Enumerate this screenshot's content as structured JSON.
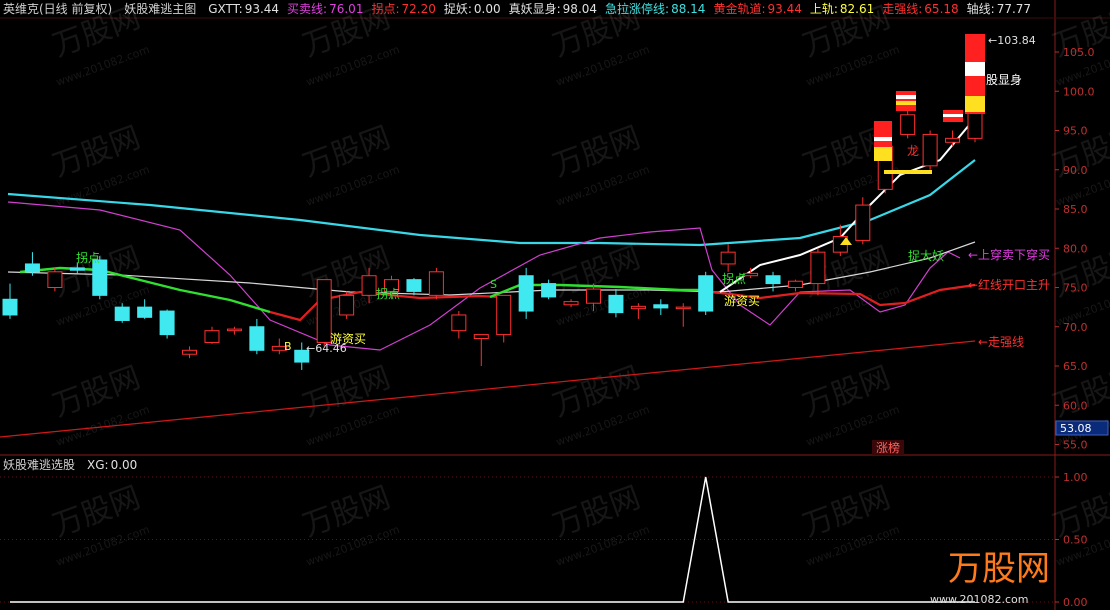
{
  "main_panel": {
    "indicators": [
      {
        "label": "英维克(日线 前复权)",
        "value": "",
        "color": "#cfcfcf"
      },
      {
        "label": "妖股难逃主图",
        "value": "",
        "color": "#cfcfcf"
      },
      {
        "label": "GXTT:",
        "value": "93.44",
        "color": "#e0e0e0"
      },
      {
        "label": "买卖线:",
        "value": "76.01",
        "color": "#e040e0"
      },
      {
        "label": "拐点:",
        "value": "72.20",
        "color": "#ff3030"
      },
      {
        "label": "捉妖:",
        "value": "0.00",
        "color": "#e0e0e0"
      },
      {
        "label": "真妖显身:",
        "value": "98.04",
        "color": "#e0e0e0"
      },
      {
        "label": "急拉涨停线:",
        "value": "88.14",
        "color": "#40e0e0"
      },
      {
        "label": "黄金轨道:",
        "value": "93.44",
        "color": "#ff3030"
      },
      {
        "label": "上轨:",
        "value": "82.61",
        "color": "#ffff40"
      },
      {
        "label": "走强线:",
        "value": "65.18",
        "color": "#ff3030"
      },
      {
        "label": "轴线:",
        "value": "77.77",
        "color": "#e0e0e0"
      }
    ],
    "y_axis_ticks": [
      "105.0",
      "100.0",
      "95.0",
      "90.0",
      "85.0",
      "80.0",
      "75.0",
      "70.0",
      "65.0",
      "60.0",
      "55.0"
    ],
    "current_price_label": "53.08",
    "annotations": {
      "high_price": "103.84",
      "low_price": "64.46",
      "guaidian_1": "拐点",
      "guaidian_2": "拐点",
      "guaidian_3": "拐点",
      "youzi_buy_1": "游资买",
      "youzi_buy_2": "游资买",
      "b_mark": "B",
      "s_mark": "S",
      "long": "龙",
      "gu_xianshen": "股显身",
      "zhuo_da_yao": "捉大妖",
      "shangchuan": "上穿卖下穿买",
      "hongxian": "红线开口主升",
      "zouqiang": "走强线",
      "zhangbang": "涨榜"
    }
  },
  "sub_panel": {
    "indicators": [
      {
        "label": "妖股难逃选股",
        "value": "",
        "color": "#cfcfcf"
      },
      {
        "label": "XG:",
        "value": "0.00",
        "color": "#e0e0e0"
      }
    ],
    "y_axis_ticks": [
      "1.00",
      "0.50",
      "0.00"
    ]
  },
  "watermark": {
    "brand": "万股网",
    "url": "www.201082.com"
  },
  "chart_data": [
    {
      "type": "candlestick",
      "title": "英维克(日线 前复权)",
      "ylim": [
        52,
        106
      ],
      "candles": [
        {
          "o": 73.5,
          "h": 75.5,
          "l": 71.0,
          "c": 71.5
        },
        {
          "o": 78.0,
          "h": 79.5,
          "l": 76.5,
          "c": 77.0
        },
        {
          "o": 75.0,
          "h": 77.5,
          "l": 74.5,
          "c": 77.0
        },
        {
          "o": 77.5,
          "h": 78.2,
          "l": 76.8,
          "c": 77.2
        },
        {
          "o": 78.5,
          "h": 79.0,
          "l": 73.5,
          "c": 74.0
        },
        {
          "o": 72.5,
          "h": 73.0,
          "l": 70.5,
          "c": 70.8
        },
        {
          "o": 72.5,
          "h": 73.5,
          "l": 71.0,
          "c": 71.2
        },
        {
          "o": 72.0,
          "h": 72.2,
          "l": 68.5,
          "c": 69.0
        },
        {
          "o": 66.5,
          "h": 67.5,
          "l": 66.0,
          "c": 67.0
        },
        {
          "o": 68.0,
          "h": 70.0,
          "l": 67.8,
          "c": 69.5
        },
        {
          "o": 69.5,
          "h": 70.0,
          "l": 69.0,
          "c": 69.7
        },
        {
          "o": 70.0,
          "h": 71.0,
          "l": 66.5,
          "c": 67.0
        },
        {
          "o": 67.0,
          "h": 68.5,
          "l": 66.5,
          "c": 67.5
        },
        {
          "o": 67.0,
          "h": 68.0,
          "l": 64.5,
          "c": 65.5
        },
        {
          "o": 68.0,
          "h": 76.0,
          "l": 67.5,
          "c": 76.0
        },
        {
          "o": 71.5,
          "h": 74.5,
          "l": 71.0,
          "c": 74.0
        },
        {
          "o": 74.0,
          "h": 77.5,
          "l": 73.0,
          "c": 76.5
        },
        {
          "o": 74.5,
          "h": 76.5,
          "l": 73.5,
          "c": 76.0
        },
        {
          "o": 76.0,
          "h": 76.2,
          "l": 74.0,
          "c": 74.5
        },
        {
          "o": 74.0,
          "h": 77.5,
          "l": 73.5,
          "c": 77.0
        },
        {
          "o": 69.5,
          "h": 72.0,
          "l": 68.5,
          "c": 71.5
        },
        {
          "o": 68.5,
          "h": 69.0,
          "l": 65.0,
          "c": 69.0
        },
        {
          "o": 69.0,
          "h": 74.0,
          "l": 68.0,
          "c": 74.0
        },
        {
          "o": 76.5,
          "h": 77.5,
          "l": 71.0,
          "c": 72.0
        },
        {
          "o": 75.5,
          "h": 76.0,
          "l": 73.5,
          "c": 73.8
        },
        {
          "o": 72.8,
          "h": 73.5,
          "l": 72.5,
          "c": 73.2
        },
        {
          "o": 73.0,
          "h": 75.5,
          "l": 72.0,
          "c": 74.8
        },
        {
          "o": 74.0,
          "h": 74.8,
          "l": 71.2,
          "c": 71.8
        },
        {
          "o": 72.3,
          "h": 73.0,
          "l": 71.0,
          "c": 72.6
        },
        {
          "o": 72.8,
          "h": 73.5,
          "l": 71.5,
          "c": 72.4
        },
        {
          "o": 72.5,
          "h": 73.0,
          "l": 70.0,
          "c": 72.5
        },
        {
          "o": 76.5,
          "h": 77.0,
          "l": 71.5,
          "c": 72.0
        },
        {
          "o": 78.0,
          "h": 80.5,
          "l": 77.0,
          "c": 79.5
        },
        {
          "o": 76.5,
          "h": 77.5,
          "l": 76.2,
          "c": 76.8
        },
        {
          "o": 76.5,
          "h": 77.0,
          "l": 74.5,
          "c": 75.5
        },
        {
          "o": 75.0,
          "h": 76.0,
          "l": 74.5,
          "c": 75.8
        },
        {
          "o": 75.5,
          "h": 80.0,
          "l": 74.0,
          "c": 79.5
        },
        {
          "o": 79.5,
          "h": 83.0,
          "l": 79.0,
          "c": 81.5
        },
        {
          "o": 81.0,
          "h": 86.5,
          "l": 80.5,
          "c": 85.5
        },
        {
          "o": 87.5,
          "h": 94.5,
          "l": 87.0,
          "c": 93.0
        },
        {
          "o": 94.5,
          "h": 99.5,
          "l": 94.0,
          "c": 97.0
        },
        {
          "o": 90.5,
          "h": 95.0,
          "l": 90.0,
          "c": 94.5
        },
        {
          "o": 93.5,
          "h": 95.0,
          "l": 93.0,
          "c": 94.0
        },
        {
          "o": 94.0,
          "h": 103.84,
          "l": 93.5,
          "c": 103.84
        }
      ]
    },
    {
      "type": "line",
      "title": "妖股难逃选股",
      "ylim": [
        0,
        1.1
      ],
      "values": [
        0,
        0,
        0,
        0,
        0,
        0,
        0,
        0,
        0,
        0,
        0,
        0,
        0,
        0,
        0,
        0,
        0,
        0,
        0,
        0,
        0,
        0,
        0,
        0,
        0,
        0,
        0,
        0,
        0,
        0,
        0,
        1,
        0,
        0,
        0,
        0,
        0,
        0,
        0,
        0,
        0,
        0,
        0,
        0
      ]
    }
  ]
}
